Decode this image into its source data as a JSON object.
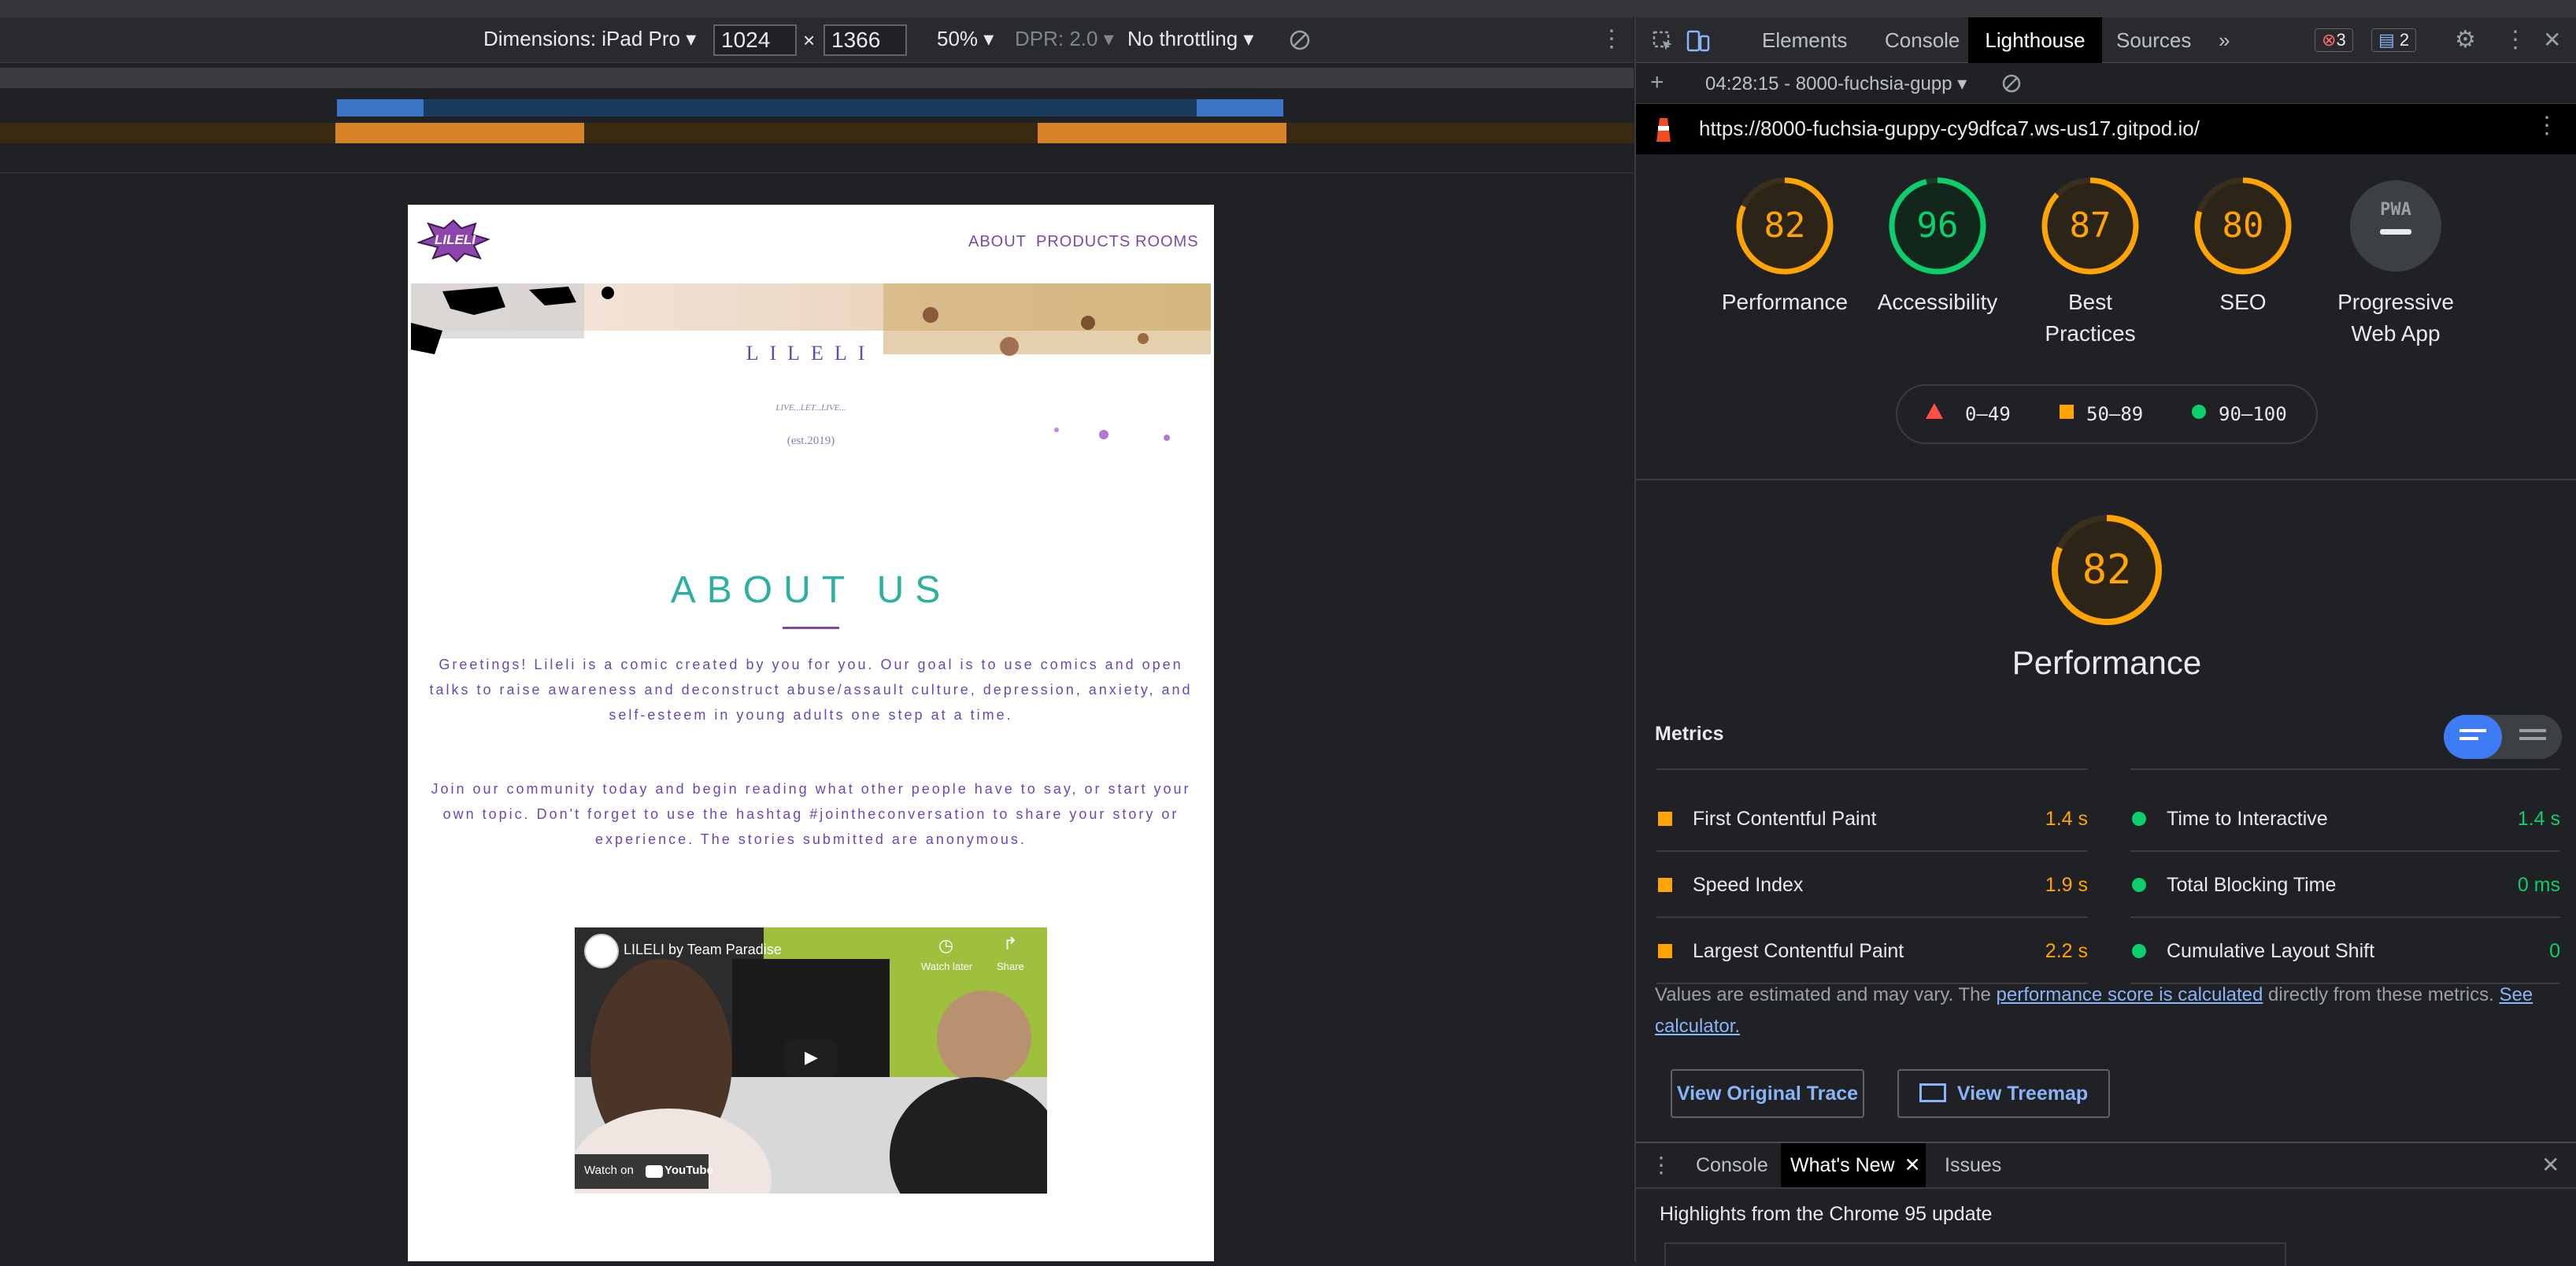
{
  "device_toolbar": {
    "dimensions_label": "Dimensions: iPad Pro",
    "width": "1024",
    "times": "×",
    "height": "1366",
    "zoom": "50%",
    "dpr": "DPR: 2.0",
    "throttling": "No throttling"
  },
  "site": {
    "logo": "LILELI",
    "nav": [
      "ABOUT",
      "PRODUCTS",
      "ROOMS"
    ],
    "hero_title": "LILELI",
    "hero_tagline": "LIVE...LET...LIVE...",
    "hero_est": "(est.2019)",
    "about_title": "ABOUT US",
    "about_p1": "Greetings! Lileli is a comic created by you for you. Our goal is to use comics and open talks to raise awareness and deconstruct abuse/assault culture, depression, anxiety, and self-esteem in young adults one step at a time.",
    "about_p2": "Join our community today and begin reading what other people have to say, or start your own topic. Don't forget to use the hashtag #jointheconversation to share your story or experience. The stories submitted are anonymous.",
    "video": {
      "title": "LILELI by Team Paradise",
      "watch_later": "Watch later",
      "share": "Share",
      "watch_on": "Watch on",
      "youtube": "YouTube"
    }
  },
  "devtools": {
    "tabs": [
      "Elements",
      "Console",
      "Lighthouse",
      "Sources",
      "»"
    ],
    "active_tab": "Lighthouse",
    "error_count": "3",
    "message_count": "2",
    "report_selector": "04:28:15 - 8000-fuchsia-gupp",
    "url": "https://8000-fuchsia-guppy-cy9dfca7.ws-us17.gitpod.io/",
    "gauges": [
      {
        "score": "82",
        "label": "Performance",
        "color": "#ffa400",
        "value": 0.82
      },
      {
        "score": "96",
        "label": "Accessibility",
        "color": "#0cce6b",
        "value": 0.96
      },
      {
        "score": "87",
        "label": "Best Practices",
        "color": "#ffa400",
        "value": 0.87
      },
      {
        "score": "80",
        "label": "SEO",
        "color": "#ffa400",
        "value": 0.8
      },
      {
        "score": "PWA",
        "label": "Progressive Web App",
        "color": "#9aa0a6",
        "value": 0
      }
    ],
    "legend": {
      "fail": "0–49",
      "average": "50–89",
      "pass": "90–100"
    },
    "perf_score": "82",
    "perf_label": "Performance",
    "metrics_title": "Metrics",
    "metrics_left": [
      {
        "name": "First Contentful Paint",
        "value": "1.4 s",
        "status": "average"
      },
      {
        "name": "Speed Index",
        "value": "1.9 s",
        "status": "average"
      },
      {
        "name": "Largest Contentful Paint",
        "value": "2.2 s",
        "status": "average"
      }
    ],
    "metrics_right": [
      {
        "name": "Time to Interactive",
        "value": "1.4 s",
        "status": "pass"
      },
      {
        "name": "Total Blocking Time",
        "value": "0 ms",
        "status": "pass"
      },
      {
        "name": "Cumulative Layout Shift",
        "value": "0",
        "status": "pass"
      }
    ],
    "note_prefix": "Values are estimated and may vary. The ",
    "note_link1": "performance score is calculated",
    "note_mid": " directly from these metrics. ",
    "note_link2": "See calculator.",
    "btn_trace": "View Original Trace",
    "btn_treemap": "View Treemap",
    "drawer_tabs": [
      "Console",
      "What's New",
      "Issues"
    ],
    "drawer_active": "What's New",
    "drawer_text": "Highlights from the Chrome 95 update",
    "colors": {
      "average": "#ffa400",
      "pass": "#0cce6b",
      "fail": "#ff4e42"
    }
  }
}
